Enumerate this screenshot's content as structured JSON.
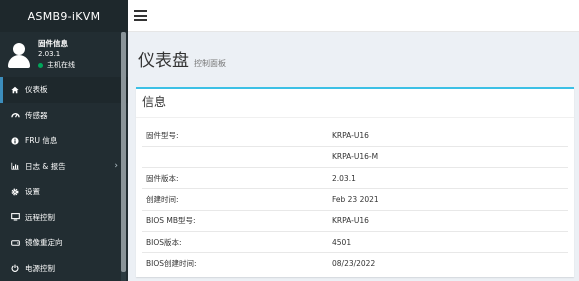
{
  "brand": "ASMB9-iKVM",
  "user": {
    "name": "固件信息",
    "version": "2.03.1",
    "status": "主机在线"
  },
  "menu": [
    {
      "label": "仪表板",
      "icon": "home-icon"
    },
    {
      "label": "传感器",
      "icon": "gauge-icon"
    },
    {
      "label": "FRU 信息",
      "icon": "info-icon"
    },
    {
      "label": "日志 & 报告",
      "icon": "bar-chart-icon"
    },
    {
      "label": "设置",
      "icon": "gear-icon"
    },
    {
      "label": "远程控制",
      "icon": "monitor-icon"
    },
    {
      "label": "镜像重定向",
      "icon": "drive-icon"
    },
    {
      "label": "电源控制",
      "icon": "power-icon"
    }
  ],
  "page": {
    "title": "仪表盘",
    "subtitle": "控制面板"
  },
  "box": {
    "title": "信息",
    "rows": [
      {
        "key": "固件型号:",
        "value": "KRPA-U16"
      },
      {
        "key": "",
        "value": "KRPA-U16-M"
      },
      {
        "key": "固件版本:",
        "value": "2.03.1"
      },
      {
        "key": "创建时间:",
        "value": "Feb 23 2021"
      },
      {
        "key": "BIOS MB型号:",
        "value": "KRPA-U16"
      },
      {
        "key": "BIOS版本:",
        "value": "4501"
      },
      {
        "key": "BIOS创建时间:",
        "value": "08/23/2022"
      }
    ]
  },
  "colors": {
    "sidebar": "#222d32",
    "accent": "#3c8dbc",
    "box_border": "#3cc0e5",
    "online": "#00a65a"
  }
}
